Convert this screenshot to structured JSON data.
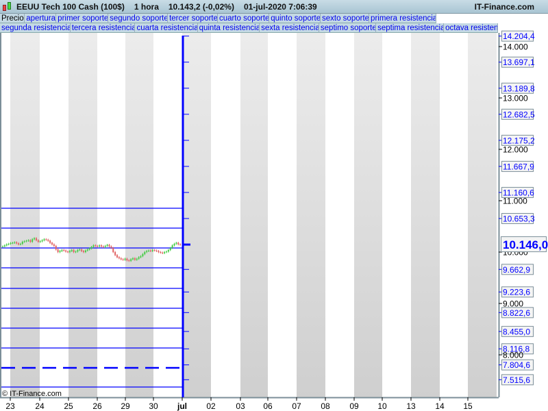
{
  "header": {
    "instrument": "EEUU Tech 100 Cash (100$)",
    "timeframe": "1 hora",
    "price": "10.143,2 (-0,02%)",
    "datetime": "01-jul-2020 7:06:39",
    "site": "IT-Finance.com"
  },
  "toolbar_row1": [
    "Precio",
    "apertura",
    "primer soporte",
    "segundo soporte",
    "tercer soporte",
    "cuarto soporte",
    "quinto soporte",
    "sexto soporte",
    "primera resistencia"
  ],
  "toolbar_row2": [
    "segunda resistencia",
    "tercera resistencia",
    "cuarta resistencia",
    "quinta resistencia",
    "sexta resistencia",
    "septimo soporte",
    "septima resistencia",
    "octava resisten"
  ],
  "watermark": "© IT-Finance.com",
  "chart_data": {
    "type": "candlestick",
    "x_ticks": [
      "23",
      "24",
      "25",
      "26",
      "29",
      "30",
      "jul",
      "02",
      "03",
      "06",
      "07",
      "08",
      "09",
      "10",
      "13",
      "14",
      "15"
    ],
    "y_ticks": [
      "14.000",
      "13.000",
      "12.000",
      "11.000",
      "10.000",
      "9.000",
      "8.000"
    ],
    "y_tick_values": [
      14000,
      13000,
      12000,
      11000,
      10000,
      9000,
      8000
    ],
    "level_labels": [
      "14.204,4",
      "13.697,1",
      "13.189,8",
      "12.682,5",
      "12.175,2",
      "11.667,9",
      "11.160,6",
      "10.653,3",
      "9.662,9",
      "9.223,6",
      "8.822,6",
      "8.455,0",
      "8.116,8",
      "7.804,6",
      "7.515,6"
    ],
    "level_values": [
      14204.4,
      13697.1,
      13189.8,
      12682.5,
      12175.2,
      11667.9,
      11160.6,
      10653.3,
      9662.9,
      9223.6,
      8822.6,
      8455.0,
      8116.8,
      7804.6,
      7515.6
    ],
    "current_label": "10.146,0",
    "current_value": 10146.0,
    "hlines": [
      10853,
      10467,
      10080,
      9693,
      9293,
      8907,
      8520,
      8133,
      7747,
      7373
    ],
    "dashed_hline": 7747,
    "closes": [
      10110,
      10130,
      10150,
      10160,
      10175,
      10180,
      10190,
      10170,
      10150,
      10160,
      10200,
      10210,
      10220,
      10230,
      10200,
      10250,
      10270,
      10230,
      10200,
      10210,
      10230,
      10250,
      10240,
      10220,
      10180,
      10150,
      10120,
      10050,
      10000,
      10020,
      10040,
      10030,
      10010,
      10000,
      10020,
      10040,
      10000,
      10010,
      10040,
      10050,
      10020,
      10000,
      10030,
      10050,
      10070,
      10100,
      10130,
      10120,
      10110,
      10130,
      10110,
      10100,
      10120,
      10140,
      10110,
      10080,
      10000,
      9940,
      9900,
      9880,
      9860,
      9850,
      9870,
      9840,
      9830,
      9860,
      9880,
      9850,
      9870,
      9900,
      9920,
      9960,
      10000,
      10020,
      10030,
      10020,
      10040,
      10030,
      10020,
      10000,
      9990,
      9980,
      10000,
      10010,
      10040,
      10080,
      10130,
      10160,
      10180,
      10150,
      10146
    ],
    "ylim": [
      7300,
      14300
    ]
  },
  "colors": {
    "up": "#44cc44",
    "down": "#e06060",
    "line": "#0000ff",
    "band": "#d4d4d4"
  }
}
